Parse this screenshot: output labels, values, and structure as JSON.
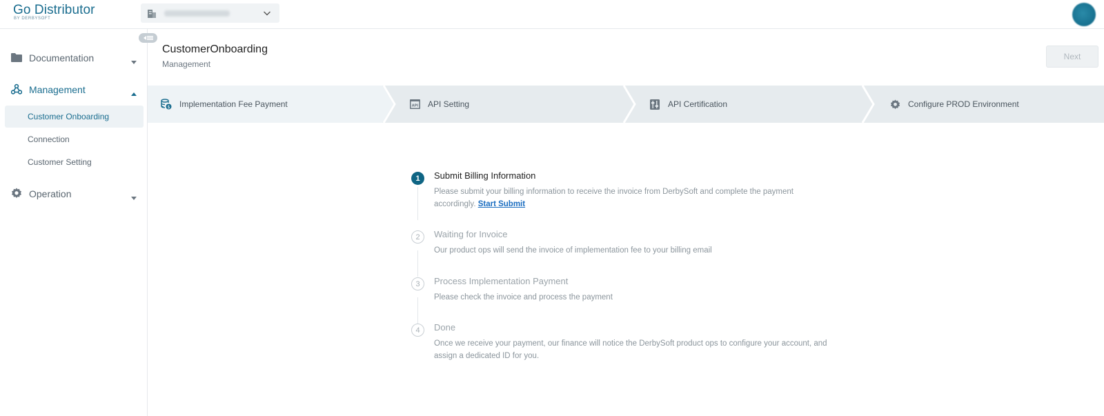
{
  "app": {
    "logo_main": "Go Distributor",
    "logo_sub": "BY DERBYSOFT"
  },
  "colors": {
    "brand": "#1a6d8f",
    "step_active_bg": "#eef3f6",
    "link": "#1a6dc0"
  },
  "sidebar": {
    "groups": [
      {
        "label": "Documentation",
        "icon": "folder-icon",
        "expanded": false
      },
      {
        "label": "Management",
        "icon": "network-icon",
        "expanded": true,
        "items": [
          "Customer Onboarding",
          "Connection",
          "Customer Setting"
        ]
      },
      {
        "label": "Operation",
        "icon": "gear-icon",
        "expanded": false
      }
    ]
  },
  "header": {
    "title": "CustomerOnboarding",
    "subtitle": "Management",
    "next_label": "Next"
  },
  "steps": [
    {
      "label": "Implementation Fee Payment",
      "icon": "coin-stack-icon",
      "active": true
    },
    {
      "label": "API Setting",
      "icon": "api-window-icon",
      "active": false
    },
    {
      "label": "API Certification",
      "icon": "sliders-icon",
      "active": false
    },
    {
      "label": "Configure PROD Environment",
      "icon": "gear-icon",
      "active": false
    }
  ],
  "timeline": [
    {
      "number": "1",
      "title": "Submit Billing Information",
      "desc": "Please submit your billing information to receive the invoice from DerbySoft and complete the payment accordingly.",
      "link": "Start Submit",
      "active": true
    },
    {
      "number": "2",
      "title": "Waiting for Invoice",
      "desc": "Our product ops will send the invoice of implementation fee to your billing email",
      "active": false
    },
    {
      "number": "3",
      "title": "Process Implementation Payment",
      "desc": "Please check the invoice and process the payment",
      "active": false
    },
    {
      "number": "4",
      "title": "Done",
      "desc": "Once we receive your payment, our finance will notice the DerbySoft product ops to configure your account, and assign a dedicated ID for you.",
      "active": false
    }
  ]
}
